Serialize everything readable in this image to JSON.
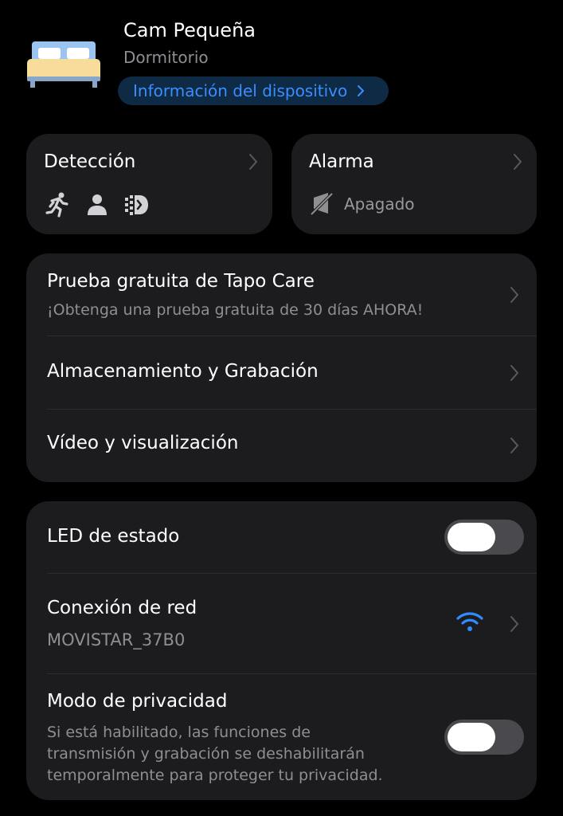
{
  "header": {
    "device_name": "Cam Pequeña",
    "room": "Dormitorio",
    "info_link": "Información del dispositivo"
  },
  "detection_card": {
    "title": "Detección",
    "icons": [
      "running-person-icon",
      "person-icon",
      "motion-detection-icon"
    ]
  },
  "alarm_card": {
    "title": "Alarma",
    "status": "Apagado",
    "icon": "alarm-off-icon"
  },
  "menu": {
    "tapo_care": {
      "title": "Prueba gratuita de Tapo Care",
      "subtitle": "¡Obtenga una prueba gratuita de 30 días AHORA!"
    },
    "storage": {
      "title": "Almacenamiento y Grabación"
    },
    "video": {
      "title": "Vídeo y visualización"
    }
  },
  "settings": {
    "led": {
      "title": "LED de estado",
      "enabled": false
    },
    "network": {
      "title": "Conexión de red",
      "ssid": "MOVISTAR_37B0"
    },
    "privacy": {
      "title": "Modo de privacidad",
      "description_lines": [
        "Si está habilitado, las funciones de",
        "transmisión y grabación se deshabilitarán",
        "temporalmente para proteger tu privacidad."
      ],
      "enabled": false
    }
  },
  "colors": {
    "background": "#000000",
    "card": "#1c1c1e",
    "accent_blue": "#3a8eff",
    "pill_bg": "#0f2a44",
    "secondary_text": "#8e8e93",
    "toggle_off": "#4a4a4e"
  }
}
